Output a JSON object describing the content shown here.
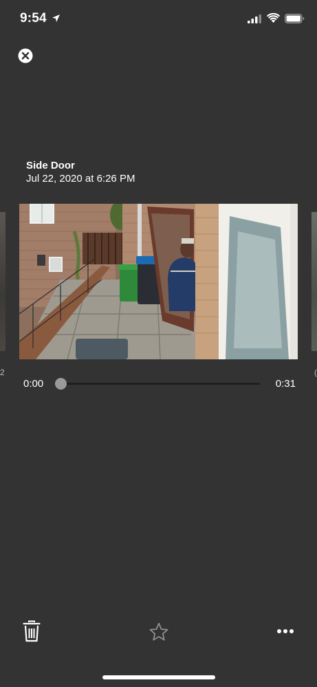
{
  "status_bar": {
    "time": "9:54",
    "icons": [
      "location-arrow-icon",
      "cellular-signal-icon",
      "wifi-icon",
      "battery-icon"
    ]
  },
  "header": {
    "close_icon": "close-icon",
    "camera_name": "Side Door",
    "event_datetime": "Jul 22, 2020 at 6:26 PM"
  },
  "carousel": {
    "prev_label": "2",
    "next_label": "("
  },
  "player": {
    "elapsed": "0:00",
    "total": "0:31",
    "progress": 0
  },
  "toolbar": {
    "icons": [
      "trash-icon",
      "star-icon",
      "more-icon"
    ]
  },
  "colors": {
    "background": "#333333",
    "text": "#ffffff",
    "track": "#1f1f1f",
    "thumb": "#9a9a9a"
  }
}
